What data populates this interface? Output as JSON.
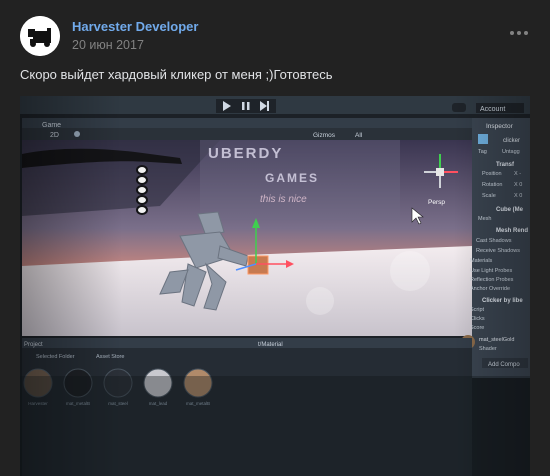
{
  "post": {
    "author": "Harvester Developer",
    "date": "20 июн 2017",
    "text": "Скоро выйдет хардовый кликер от меня ;)Готовтесь",
    "more_icon": "more-dots-icon"
  },
  "unity": {
    "tab_game": "Game",
    "view_2d": "2D",
    "gizmos": "Gizmos",
    "all": "All",
    "account": "Account",
    "inspector_title": "Inspector",
    "object_name": "clicker",
    "tag_label": "Tag",
    "tag_value": "Untagg",
    "transform": "Transf",
    "position": "Position",
    "rotation": "Rotation",
    "scale": "Scale",
    "rotation_x": "X 0",
    "scale_x": "X 0",
    "position_x": "X -",
    "cube_mesh": "Cube (Me",
    "mesh": "Mesh",
    "mesh_renderer": "Mesh Rend",
    "cast_shadows": "Cast Shadows",
    "receive_shadows": "Receive Shadows",
    "materials": "Materials",
    "use_light_probes": "Use Light Probes",
    "reflection_probes": "Reflection Probes",
    "anchor_override": "Anchor Override",
    "clicker_script": "Clicker by libe",
    "script": "Script",
    "clicks": "Clicks",
    "score": "Score",
    "material_name": "mat_steelGold",
    "shader": "Shader",
    "add_component": "Add Compo",
    "persp": "Persp",
    "project_tab": "Project",
    "selected_folder": "Selected Folder",
    "asset_store": "Asset Store",
    "breadcrumb": "t/Material",
    "scene_title_1": "UBERDY",
    "scene_title_2": "GAMES",
    "scene_subtitle": "this is nice",
    "assets": [
      "Harvester",
      "mat_metalB",
      "mat_steel",
      "mat_lead",
      "mat_metalB"
    ]
  }
}
